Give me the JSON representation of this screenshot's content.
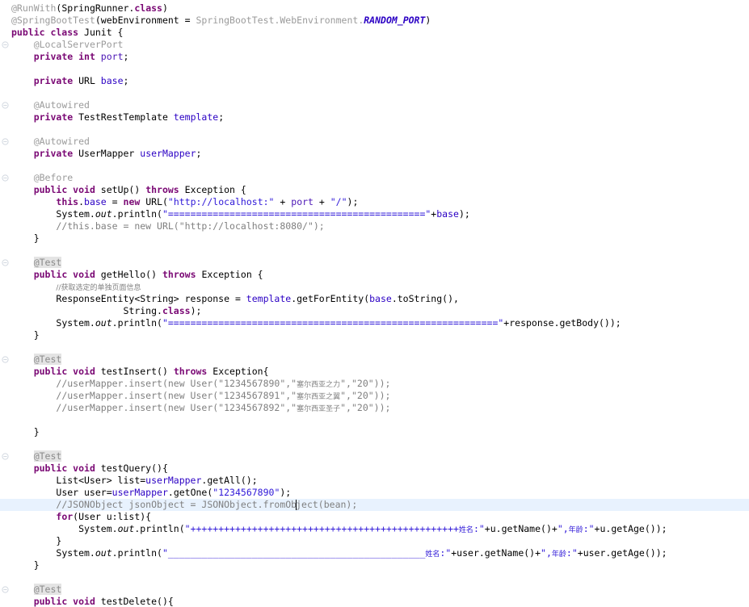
{
  "editor": {
    "app": "java-code-editor",
    "language": "Java",
    "file_title": "Junit.java",
    "theme": {
      "background": "#ffffff",
      "keyword": "#7a0874",
      "string": "#2f18d8",
      "comment": "#808080",
      "annotation": "#9b9b9b",
      "field": "#4a14b5",
      "field_blue": "#2b00c4",
      "current_line_highlight": "#e8f2fe",
      "annotation_highlight": "#e4e4e4",
      "foreground": "#000000"
    },
    "current_line_number": 42,
    "caret_visible": true
  },
  "gutter": {
    "fold_marker_icon": "fold-collapse-icon",
    "marker_line_indexes": [
      3,
      8,
      11,
      14,
      21,
      29,
      37,
      48
    ]
  },
  "code": {
    "lines": [
      {
        "n": 1,
        "indent": 0,
        "tokens": [
          {
            "c": "ann",
            "t": "@RunWith"
          },
          {
            "c": "plain",
            "t": "("
          },
          {
            "c": "plain",
            "t": "SpringRunner"
          },
          {
            "c": "plain",
            "t": "."
          },
          {
            "c": "kw",
            "t": "class"
          },
          {
            "c": "plain",
            "t": ")"
          }
        ]
      },
      {
        "n": 2,
        "indent": 0,
        "tokens": [
          {
            "c": "ann",
            "t": "@SpringBootTest"
          },
          {
            "c": "plain",
            "t": "("
          },
          {
            "c": "plain",
            "t": "webEnvironment = "
          },
          {
            "c": "ann",
            "t": "SpringBootTest"
          },
          {
            "c": "ann",
            "t": "."
          },
          {
            "c": "ann",
            "t": "WebEnvironment"
          },
          {
            "c": "ann",
            "t": "."
          },
          {
            "c": "statb",
            "t": "RANDOM_PORT"
          },
          {
            "c": "plain",
            "t": ")"
          }
        ]
      },
      {
        "n": 3,
        "indent": 0,
        "tokens": [
          {
            "c": "kw",
            "t": "public class "
          },
          {
            "c": "plain",
            "t": "Junit {"
          }
        ]
      },
      {
        "n": 4,
        "indent": 1,
        "tokens": [
          {
            "c": "ann",
            "t": "@LocalServerPort"
          }
        ]
      },
      {
        "n": 5,
        "indent": 1,
        "tokens": [
          {
            "c": "kw",
            "t": "private int "
          },
          {
            "c": "field",
            "t": "port"
          },
          {
            "c": "plain",
            "t": ";"
          }
        ]
      },
      {
        "n": 6,
        "indent": 0,
        "tokens": []
      },
      {
        "n": 7,
        "indent": 1,
        "tokens": [
          {
            "c": "kw",
            "t": "private "
          },
          {
            "c": "plain",
            "t": "URL "
          },
          {
            "c": "fieldb",
            "t": "base"
          },
          {
            "c": "plain",
            "t": ";"
          }
        ]
      },
      {
        "n": 8,
        "indent": 0,
        "tokens": []
      },
      {
        "n": 9,
        "indent": 1,
        "tokens": [
          {
            "c": "ann",
            "t": "@Autowired"
          }
        ]
      },
      {
        "n": 10,
        "indent": 1,
        "tokens": [
          {
            "c": "kw",
            "t": "private "
          },
          {
            "c": "plain",
            "t": "TestRestTemplate "
          },
          {
            "c": "fieldb",
            "t": "template"
          },
          {
            "c": "plain",
            "t": ";"
          }
        ]
      },
      {
        "n": 11,
        "indent": 0,
        "tokens": []
      },
      {
        "n": 12,
        "indent": 1,
        "tokens": [
          {
            "c": "ann",
            "t": "@Autowired"
          }
        ]
      },
      {
        "n": 13,
        "indent": 1,
        "tokens": [
          {
            "c": "kw",
            "t": "private "
          },
          {
            "c": "plain",
            "t": "UserMapper "
          },
          {
            "c": "fieldb",
            "t": "userMapper"
          },
          {
            "c": "plain",
            "t": ";"
          }
        ]
      },
      {
        "n": 14,
        "indent": 0,
        "tokens": []
      },
      {
        "n": 15,
        "indent": 1,
        "tokens": [
          {
            "c": "ann",
            "t": "@Before"
          }
        ]
      },
      {
        "n": 16,
        "indent": 1,
        "tokens": [
          {
            "c": "kw",
            "t": "public void "
          },
          {
            "c": "plain",
            "t": "setUp() "
          },
          {
            "c": "kw",
            "t": "throws "
          },
          {
            "c": "plain",
            "t": "Exception {"
          }
        ]
      },
      {
        "n": 17,
        "indent": 2,
        "tokens": [
          {
            "c": "kw",
            "t": "this"
          },
          {
            "c": "plain",
            "t": "."
          },
          {
            "c": "fieldb",
            "t": "base"
          },
          {
            "c": "plain",
            "t": " = "
          },
          {
            "c": "kw",
            "t": "new "
          },
          {
            "c": "plain",
            "t": "URL("
          },
          {
            "c": "str",
            "t": "\"http://localhost:\""
          },
          {
            "c": "plain",
            "t": " + "
          },
          {
            "c": "field",
            "t": "port"
          },
          {
            "c": "plain",
            "t": " + "
          },
          {
            "c": "str",
            "t": "\"/\""
          },
          {
            "c": "plain",
            "t": ");"
          }
        ]
      },
      {
        "n": 18,
        "indent": 2,
        "tokens": [
          {
            "c": "plain",
            "t": "System."
          },
          {
            "c": "stat",
            "t": "out"
          },
          {
            "c": "plain",
            "t": ".println("
          },
          {
            "c": "str",
            "t": "\"==============================================\""
          },
          {
            "c": "plain",
            "t": "+"
          },
          {
            "c": "fieldb",
            "t": "base"
          },
          {
            "c": "plain",
            "t": ");"
          }
        ]
      },
      {
        "n": 19,
        "indent": 2,
        "tokens": [
          {
            "c": "cmt",
            "t": "//this.base = new URL(\"http://localhost:8080/\");"
          }
        ]
      },
      {
        "n": 20,
        "indent": 1,
        "tokens": [
          {
            "c": "plain",
            "t": "}"
          }
        ]
      },
      {
        "n": 21,
        "indent": 0,
        "tokens": []
      },
      {
        "n": 22,
        "indent": 1,
        "tokens": [
          {
            "c": "annhl",
            "t": "@Test"
          }
        ]
      },
      {
        "n": 23,
        "indent": 1,
        "tokens": [
          {
            "c": "kw",
            "t": "public void "
          },
          {
            "c": "plain",
            "t": "getHello() "
          },
          {
            "c": "kw",
            "t": "throws "
          },
          {
            "c": "plain",
            "t": "Exception {"
          }
        ]
      },
      {
        "n": 24,
        "indent": 2,
        "tokens": [
          {
            "c": "cmt cn",
            "t": "//获取选定的单独页面信息"
          }
        ]
      },
      {
        "n": 25,
        "indent": 2,
        "tokens": [
          {
            "c": "plain",
            "t": "ResponseEntity<String> response = "
          },
          {
            "c": "fieldb",
            "t": "template"
          },
          {
            "c": "plain",
            "t": ".getForEntity("
          },
          {
            "c": "fieldb",
            "t": "base"
          },
          {
            "c": "plain",
            "t": ".toString(),"
          }
        ]
      },
      {
        "n": 26,
        "indent": 5,
        "tokens": [
          {
            "c": "plain",
            "t": "String."
          },
          {
            "c": "kw",
            "t": "class"
          },
          {
            "c": "plain",
            "t": ");"
          }
        ]
      },
      {
        "n": 27,
        "indent": 2,
        "tokens": [
          {
            "c": "plain",
            "t": "System."
          },
          {
            "c": "stat",
            "t": "out"
          },
          {
            "c": "plain",
            "t": ".println("
          },
          {
            "c": "str",
            "t": "\"===========================================================\""
          },
          {
            "c": "plain",
            "t": "+response.getBody());"
          }
        ]
      },
      {
        "n": 28,
        "indent": 1,
        "tokens": [
          {
            "c": "plain",
            "t": "}"
          }
        ]
      },
      {
        "n": 29,
        "indent": 0,
        "tokens": []
      },
      {
        "n": 30,
        "indent": 1,
        "tokens": [
          {
            "c": "annhl",
            "t": "@Test"
          }
        ]
      },
      {
        "n": 31,
        "indent": 1,
        "tokens": [
          {
            "c": "kw",
            "t": "public void "
          },
          {
            "c": "plain",
            "t": "testInsert() "
          },
          {
            "c": "kw",
            "t": "throws "
          },
          {
            "c": "plain",
            "t": "Exception{"
          }
        ]
      },
      {
        "n": 32,
        "indent": 2,
        "tokens": [
          {
            "c": "cmt",
            "t": "//userMapper.insert(new User(\"1234567890\",\""
          },
          {
            "c": "cmt cn",
            "t": "塞尔西亚之力"
          },
          {
            "c": "cmt",
            "t": "\",\"20\"));"
          }
        ]
      },
      {
        "n": 33,
        "indent": 2,
        "tokens": [
          {
            "c": "cmt",
            "t": "//userMapper.insert(new User(\"1234567891\",\""
          },
          {
            "c": "cmt cn",
            "t": "塞尔西亚之翼"
          },
          {
            "c": "cmt",
            "t": "\",\"20\"));"
          }
        ]
      },
      {
        "n": 34,
        "indent": 2,
        "tokens": [
          {
            "c": "cmt",
            "t": "//userMapper.insert(new User(\"1234567892\",\""
          },
          {
            "c": "cmt cn",
            "t": "塞尔西亚圣子"
          },
          {
            "c": "cmt",
            "t": "\",\"20\"));"
          }
        ]
      },
      {
        "n": 35,
        "indent": 0,
        "tokens": []
      },
      {
        "n": 36,
        "indent": 1,
        "tokens": [
          {
            "c": "plain",
            "t": "}"
          }
        ]
      },
      {
        "n": 37,
        "indent": 0,
        "tokens": []
      },
      {
        "n": 38,
        "indent": 1,
        "tokens": [
          {
            "c": "annhl",
            "t": "@Test"
          }
        ]
      },
      {
        "n": 39,
        "indent": 1,
        "tokens": [
          {
            "c": "kw",
            "t": "public void "
          },
          {
            "c": "plain",
            "t": "testQuery(){"
          }
        ]
      },
      {
        "n": 40,
        "indent": 2,
        "tokens": [
          {
            "c": "plain",
            "t": "List<User> list="
          },
          {
            "c": "fieldb",
            "t": "userMapper"
          },
          {
            "c": "plain",
            "t": ".getAll();"
          }
        ]
      },
      {
        "n": 41,
        "indent": 2,
        "tokens": [
          {
            "c": "plain",
            "t": "User user="
          },
          {
            "c": "fieldb",
            "t": "userMapper"
          },
          {
            "c": "plain",
            "t": ".getOne("
          },
          {
            "c": "str",
            "t": "\"1234567890\""
          },
          {
            "c": "plain",
            "t": ");"
          }
        ]
      },
      {
        "n": 42,
        "indent": 2,
        "highlight": true,
        "caret_after": 43,
        "tokens": [
          {
            "c": "cmt",
            "t": "//JSONObject jsonObject = JSONObject.fromObject(bean);"
          }
        ]
      },
      {
        "n": 43,
        "indent": 2,
        "tokens": [
          {
            "c": "kw",
            "t": "for"
          },
          {
            "c": "plain",
            "t": "(User u:list){"
          }
        ]
      },
      {
        "n": 44,
        "indent": 3,
        "tokens": [
          {
            "c": "plain",
            "t": "System."
          },
          {
            "c": "stat",
            "t": "out"
          },
          {
            "c": "plain",
            "t": ".println("
          },
          {
            "c": "str",
            "t": "\"++++++++++++++++++++++++++++++++++++++++++++++++"
          },
          {
            "c": "str cn",
            "t": "姓名"
          },
          {
            "c": "str",
            "t": ":\""
          },
          {
            "c": "plain",
            "t": "+u.getName()+"
          },
          {
            "c": "str",
            "t": "\","
          },
          {
            "c": "str cn",
            "t": "年龄"
          },
          {
            "c": "str",
            "t": ":\""
          },
          {
            "c": "plain",
            "t": "+u.getAge());"
          }
        ]
      },
      {
        "n": 45,
        "indent": 2,
        "tokens": [
          {
            "c": "plain",
            "t": "}"
          }
        ]
      },
      {
        "n": 46,
        "indent": 2,
        "tokens": [
          {
            "c": "plain",
            "t": "System."
          },
          {
            "c": "stat",
            "t": "out"
          },
          {
            "c": "plain",
            "t": ".println("
          },
          {
            "c": "str",
            "t": "\"______________________________________________"
          },
          {
            "c": "str cn",
            "t": "姓名"
          },
          {
            "c": "str",
            "t": ":\""
          },
          {
            "c": "plain",
            "t": "+user.getName()+"
          },
          {
            "c": "str",
            "t": "\","
          },
          {
            "c": "str cn",
            "t": "年龄"
          },
          {
            "c": "str",
            "t": ":\""
          },
          {
            "c": "plain",
            "t": "+user.getAge());"
          }
        ]
      },
      {
        "n": 47,
        "indent": 1,
        "tokens": [
          {
            "c": "plain",
            "t": "}"
          }
        ]
      },
      {
        "n": 48,
        "indent": 0,
        "tokens": []
      },
      {
        "n": 49,
        "indent": 1,
        "tokens": [
          {
            "c": "annhl",
            "t": "@Test"
          }
        ]
      },
      {
        "n": 50,
        "indent": 1,
        "tokens": [
          {
            "c": "kw",
            "t": "public void "
          },
          {
            "c": "plain",
            "t": "testDelete(){"
          }
        ]
      }
    ]
  }
}
